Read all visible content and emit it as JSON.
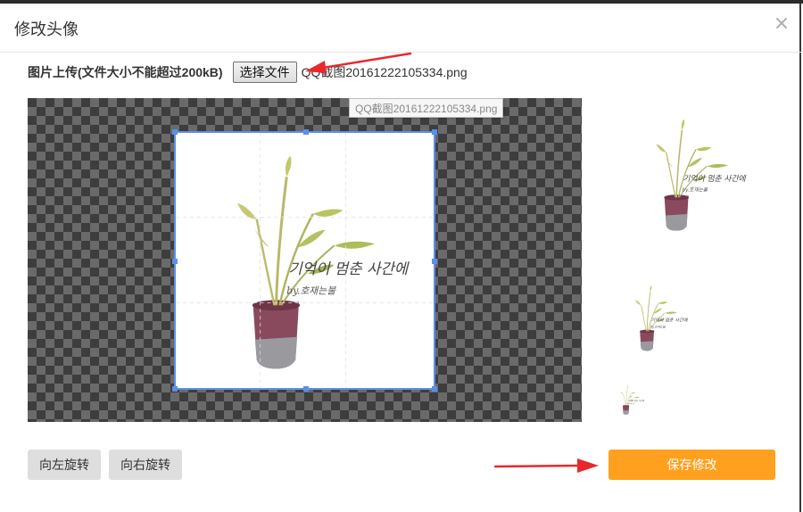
{
  "dialog": {
    "title": "修改头像",
    "close_icon": "close-icon"
  },
  "upload": {
    "label": "图片上传(文件大小不能超过200kB)",
    "button_label": "选择文件",
    "file_name": "QQ截图20161222105334.png",
    "tooltip": "QQ截图20161222105334.png"
  },
  "image": {
    "caption_korean": "기억이 멈춘 사간에",
    "caption_sub": "by.호재는불",
    "plant_icon": "potted-plant-image"
  },
  "actions": {
    "rotate_left": "向左旋转",
    "rotate_right": "向右旋转",
    "save": "保存修改"
  },
  "colors": {
    "accent": "#ffa01e",
    "crop_border": "#5b8fe8",
    "annotation_arrow": "#e8282d"
  }
}
